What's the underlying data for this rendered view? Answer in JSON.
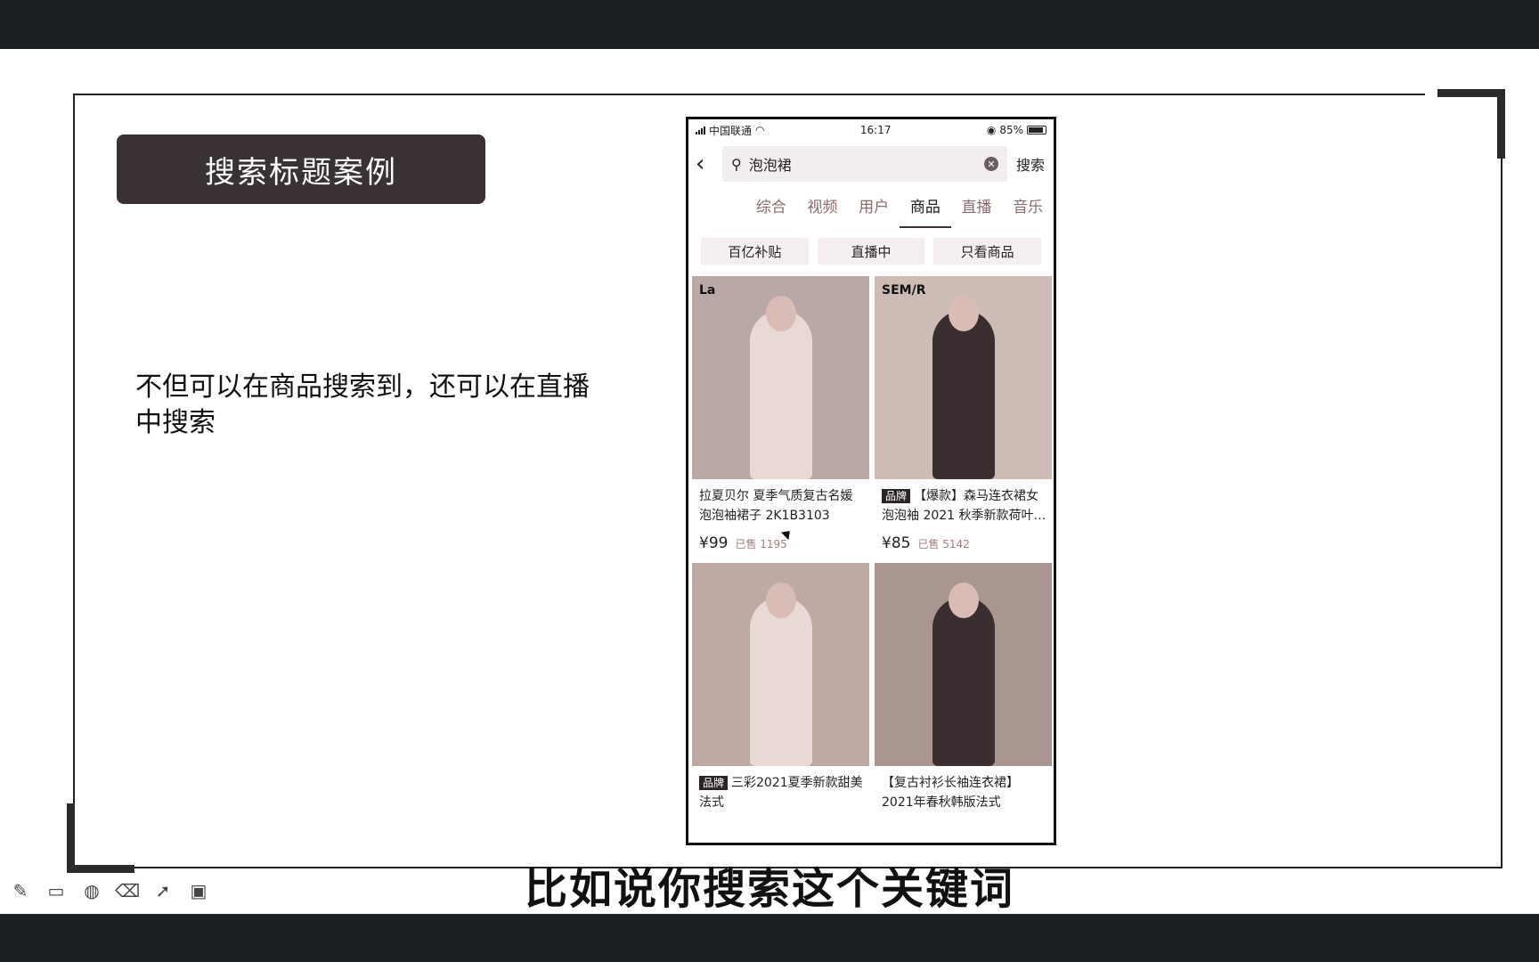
{
  "slide": {
    "title": "搜索标题案例",
    "body": "不但可以在商品搜索到，还可以在直播中搜索",
    "subtitle": "比如说你搜索这个关键词"
  },
  "phone": {
    "status": {
      "carrier": "中国联通",
      "time": "16:17",
      "battery": "85%"
    },
    "search": {
      "query": "泡泡裙",
      "button": "搜索"
    },
    "tabs": [
      "综合",
      "视频",
      "用户",
      "商品",
      "直播",
      "音乐"
    ],
    "active_tab": "商品",
    "filters": [
      "百亿补贴",
      "直播中",
      "只看商品"
    ],
    "products": [
      {
        "brand_mark": "La",
        "tag": "",
        "title": "拉夏贝尔 夏季气质复古名媛泡泡袖裙子 2K1B3103",
        "price": "¥99",
        "sold": "已售 1195",
        "img_color": "#b9a8a6"
      },
      {
        "brand_mark": "SEM/R",
        "tag": "品牌",
        "title": "【爆款】森马连衣裙女泡泡袖 2021 秋季新款荷叶…",
        "price": "¥85",
        "sold": "已售 5142",
        "img_color": "#cdbbb6"
      },
      {
        "brand_mark": "",
        "tag": "品牌",
        "title": "三彩2021夏季新款甜美法式",
        "price": "",
        "sold": "",
        "img_color": "#bfa9a4"
      },
      {
        "brand_mark": "",
        "tag": "",
        "title": "【复古衬衫长袖连衣裙】2021年春秋韩版法式",
        "price": "",
        "sold": "",
        "img_color": "#a99690"
      }
    ]
  },
  "toolbar": {
    "icons": [
      "pencil-icon",
      "window-icon",
      "palette-icon",
      "eraser-icon",
      "pointer-icon",
      "screen-share-icon"
    ]
  }
}
